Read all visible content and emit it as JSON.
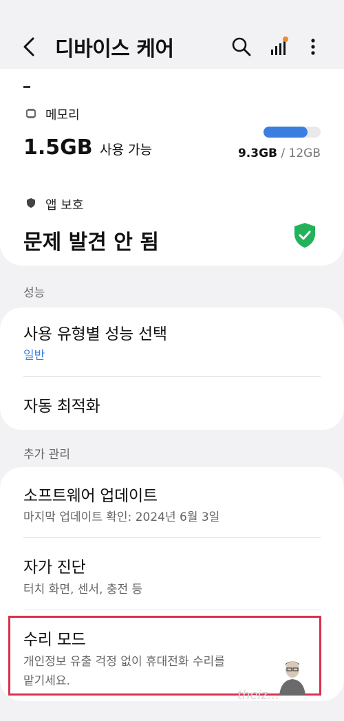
{
  "header": {
    "title": "디바이스 케어",
    "icons": [
      "back-arrow-icon",
      "search-icon",
      "signal-bars-icon",
      "more-options-icon"
    ]
  },
  "memory": {
    "label": "메모리",
    "value": "1.5GB",
    "available_label": "사용 가능",
    "used": "9.3GB",
    "separator": "/",
    "total": "12GB",
    "used_fraction": 0.775
  },
  "app_protection": {
    "label": "앱 보호",
    "status": "문제 발견 안 됨"
  },
  "performance": {
    "section_title": "성능",
    "items": [
      {
        "title": "사용 유형별 성능 선택",
        "sub": "일반"
      },
      {
        "title": "자동 최적화"
      }
    ]
  },
  "additional": {
    "section_title": "추가 관리",
    "items": [
      {
        "title": "소프트웨어 업데이트",
        "sub": "마지막 업데이트 확인: 2024년 6월 3일"
      },
      {
        "title": "자가 진단",
        "sub": "터치 화면, 센서, 충전 등"
      },
      {
        "title": "수리 모드",
        "sub1": "개인정보 유출 걱정 없이 휴대전화 수리를",
        "sub2": "맡기세요."
      }
    ]
  },
  "colors": {
    "accent_blue": "#3b7ee0",
    "shield_green": "#22b35a",
    "highlight_red": "#d9304f",
    "badge_orange": "#f08a2a"
  },
  "watermark": "theiz..."
}
